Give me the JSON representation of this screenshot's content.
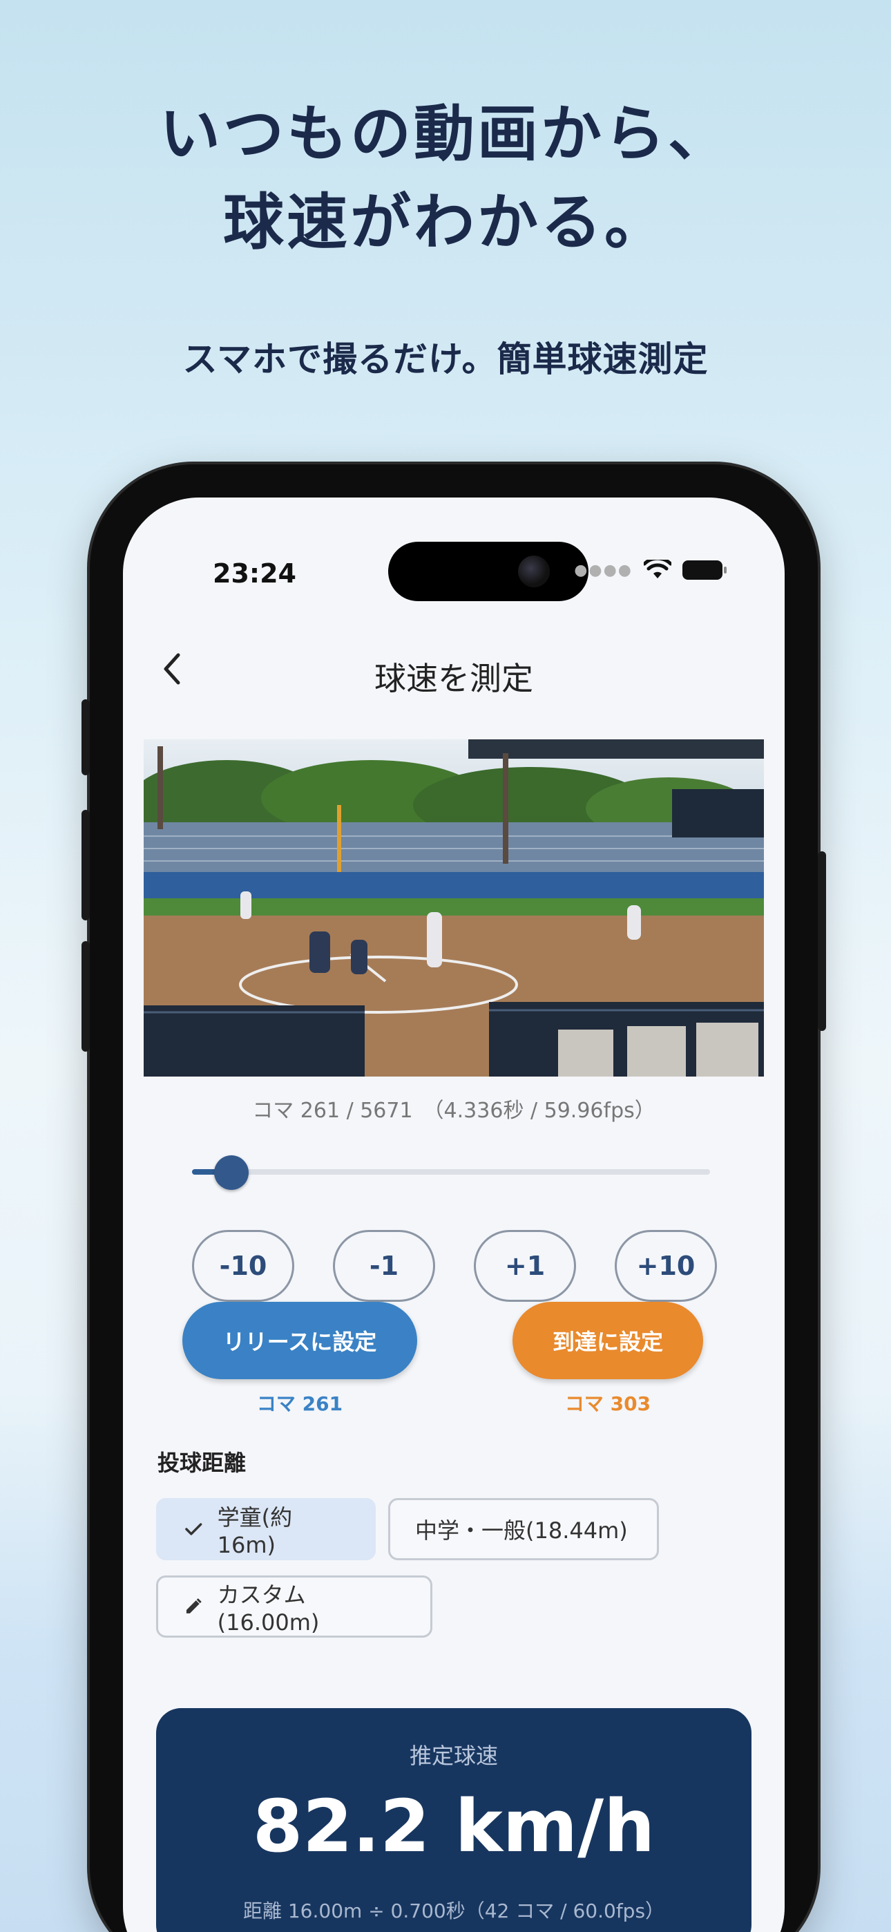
{
  "marketing": {
    "headline_line1": "いつもの動画から、",
    "headline_line2": "球速がわかる。",
    "subline": "スマホで撮るだけ。簡単球速測定"
  },
  "status_bar": {
    "time": "23:24"
  },
  "nav": {
    "title": "球速を測定",
    "back_icon": "chevron-left-icon"
  },
  "video": {
    "frame_info": "コマ 261 / 5671　（4.336秒 / 59.96fps）",
    "slider_position": 0.046
  },
  "step_buttons": [
    "-10",
    "-1",
    "+1",
    "+10"
  ],
  "release": {
    "button_label": "リリースに設定",
    "frame_label": "コマ 261",
    "color": "#3a82c5"
  },
  "arrival": {
    "button_label": "到達に設定",
    "frame_label": "コマ 303",
    "color": "#e98a2d"
  },
  "distance": {
    "title": "投球距離",
    "options": [
      {
        "label": "学童(約16m)",
        "selected": true,
        "icon": "check-icon"
      },
      {
        "label": "中学・一般(18.44m)",
        "selected": false
      },
      {
        "label": "カスタム(16.00m)",
        "selected": false,
        "icon": "pencil-icon"
      }
    ]
  },
  "result": {
    "label": "推定球速",
    "value": "82.2 km/h",
    "detail": "距離 16.00m ÷ 0.700秒（42 コマ / 60.0fps）"
  }
}
